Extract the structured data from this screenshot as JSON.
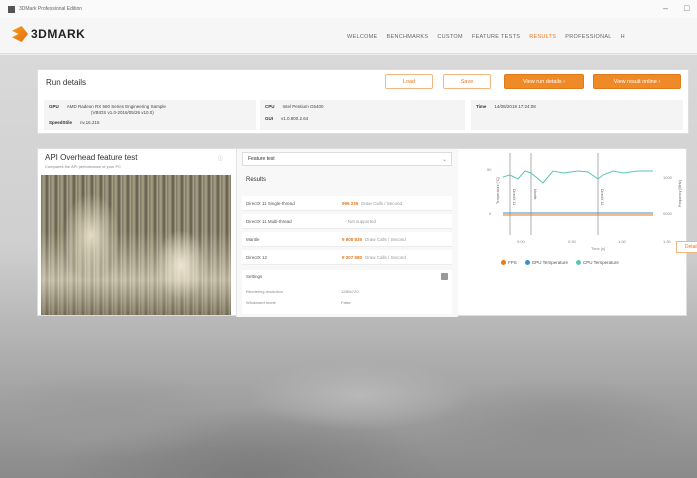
{
  "window": {
    "title": "3DMark Professional Edition"
  },
  "header": {
    "logo_text": "3DMARK",
    "nav": [
      {
        "label": "WELCOME",
        "active": false
      },
      {
        "label": "BENCHMARKS",
        "active": false
      },
      {
        "label": "CUSTOM",
        "active": false
      },
      {
        "label": "FEATURE TESTS",
        "active": false
      },
      {
        "label": "RESULTS",
        "active": true
      },
      {
        "label": "PROFESSIONAL",
        "active": false
      },
      {
        "label": "H",
        "active": false
      }
    ]
  },
  "run_details": {
    "title": "Run details",
    "buttons": {
      "load": "Load",
      "save": "Save",
      "view_run": "View run details",
      "view_result": "View result online"
    },
    "gpu_label": "GPU",
    "gpu_value": "AMD Radeon RX 560 Series Engineering Sample",
    "gpu_value2": "(VBIOS v1.0-2016/05/26 v10.0)",
    "speedstile_label": "SpeedStile",
    "speedstile_value": "nv.16.215",
    "cpu_label": "CPU",
    "cpu_value": "Intel Pentium G5400",
    "gui_label": "GUI",
    "gui_value": "v1.0.800.2.64",
    "time_label": "Time",
    "time_value": "14/08/2019 17:24:08"
  },
  "bench": {
    "title": "API Overhead feature test",
    "subtitle": "Compares the API performance of your PC",
    "dropdown": "Feature test",
    "results_label": "Results",
    "rows": [
      {
        "label": "DirectX 11 Single-thread",
        "value": "996 235",
        "unit": "Draw Calls / Second"
      },
      {
        "label": "DirectX 11 Multi-thread",
        "value": "",
        "unit": "- Not supported"
      },
      {
        "label": "Mantle",
        "value": "9 808 835",
        "unit": "Draw Calls / Second"
      },
      {
        "label": "DirectX 12",
        "value": "9 307 580",
        "unit": "Draw Calls / Second"
      }
    ],
    "settings_label": "Settings",
    "settings": [
      {
        "label": "Rendering resolution",
        "value": "1280x720"
      },
      {
        "label": "Windowed mode",
        "value": "False"
      }
    ]
  },
  "graph": {
    "more_label": "Details",
    "legend": [
      {
        "label": "FPS",
        "color": "#e8791d"
      },
      {
        "label": "GPU Temperature",
        "color": "#3a8fd0"
      },
      {
        "label": "CPU Temperature",
        "color": "#5cc6b5"
      }
    ],
    "x_ticks": [
      "0:00",
      "0:30",
      "1:00",
      "1:30"
    ],
    "y_left_ticks": [
      "50",
      "0"
    ],
    "y_right_ticks": [
      "1000",
      "0000"
    ],
    "xlabel": "Time [s]",
    "ylabel_left": "Temperature [°C]",
    "ylabel_right": "Frequency [MHz]",
    "marker_labels": [
      "DirectX 11",
      "Mantle",
      "DirectX 12"
    ]
  },
  "colors": {
    "accent": "#e8791d",
    "accent_fill": "#ef8a29"
  }
}
